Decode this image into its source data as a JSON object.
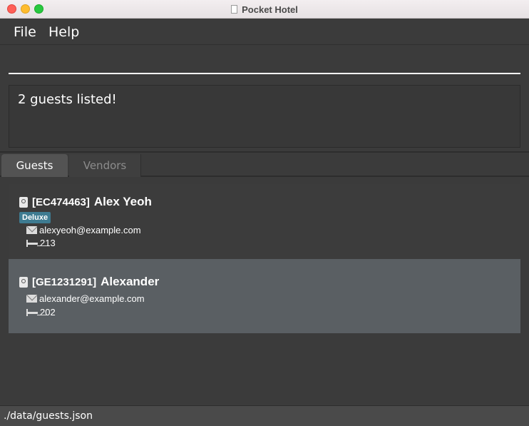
{
  "window": {
    "title": "Pocket Hotel"
  },
  "menu": {
    "file": "File",
    "help": "Help"
  },
  "command": {
    "value": "",
    "placeholder": ""
  },
  "result": {
    "text": "2 guests listed!"
  },
  "tabs": [
    {
      "label": "Guests",
      "selected": true
    },
    {
      "label": "Vendors",
      "selected": false
    }
  ],
  "guests": [
    {
      "id": "[EC474463]",
      "name": "Alex Yeoh",
      "tag": "Deluxe",
      "email": "alexyeoh@example.com",
      "room": "213",
      "selected": false
    },
    {
      "id": "[GE1231291]",
      "name": "Alexander",
      "tag": "",
      "email": "alexander@example.com",
      "room": "202",
      "selected": true
    }
  ],
  "status": {
    "path": "./data/guests.json"
  },
  "colors": {
    "tag_bg": "#3e7b91",
    "selected_card": "#5a5f63",
    "background": "#3b3b3b"
  },
  "icons": {
    "guest": "passport-icon",
    "email": "envelope-icon",
    "room": "bed-icon"
  }
}
